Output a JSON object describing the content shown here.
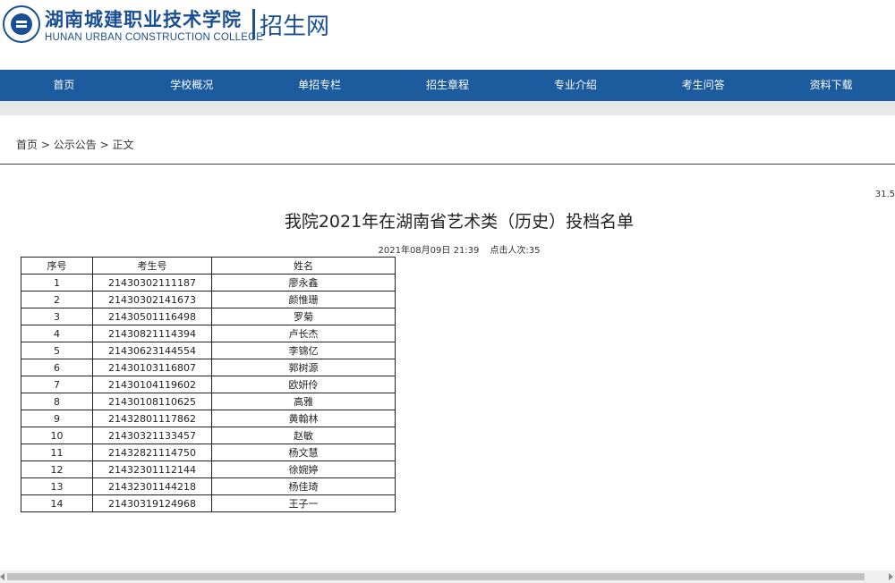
{
  "header": {
    "logo_cn": "湖南城建职业技术学院",
    "logo_en": "HUNAN URBAN CONSTRUCTION COLLEGE",
    "site_name": "招生网"
  },
  "nav": [
    "首页",
    "学校概况",
    "单招专栏",
    "招生章程",
    "专业介绍",
    "考生问答",
    "资料下载"
  ],
  "breadcrumb": {
    "home": "首页",
    "sep": ">",
    "section": "公示公告",
    "current": "正文"
  },
  "corner_number": "31.5",
  "article": {
    "title": "我院2021年在湖南省艺术类（历史）投档名单",
    "date": "2021年08月09日 21:39",
    "clicks": "点击人次:35"
  },
  "table": {
    "headers": [
      "序号",
      "考生号",
      "姓名"
    ],
    "rows": [
      [
        "1",
        "21430302111187",
        "廖永鑫"
      ],
      [
        "2",
        "21430302141673",
        "颜惟珊"
      ],
      [
        "3",
        "21430501116498",
        "罗菊"
      ],
      [
        "4",
        "21430821114394",
        "卢长杰"
      ],
      [
        "5",
        "21430623144554",
        "李锦亿"
      ],
      [
        "6",
        "21430103116807",
        "郭树源"
      ],
      [
        "7",
        "21430104119602",
        "欧妍伶"
      ],
      [
        "8",
        "21430108110625",
        "高雅"
      ],
      [
        "9",
        "21432801117862",
        "黄翰林"
      ],
      [
        "10",
        "21430321133457",
        "赵敏"
      ],
      [
        "11",
        "21432821114750",
        "杨文慧"
      ],
      [
        "12",
        "21432301112144",
        "徐婉婷"
      ],
      [
        "13",
        "21432301144218",
        "杨佳琦"
      ],
      [
        "14",
        "21430319124968",
        "王子一"
      ]
    ]
  },
  "colors": {
    "brand": "#1b4f93",
    "nav_bg": "#1b5b9e"
  }
}
